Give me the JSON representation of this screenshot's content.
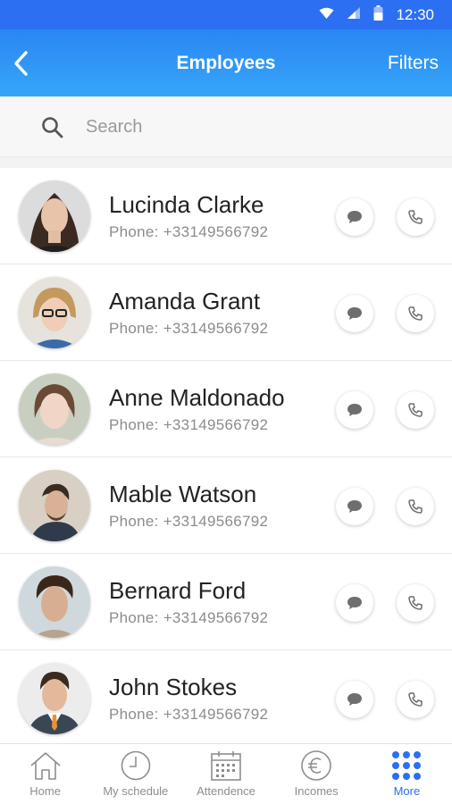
{
  "status_bar": {
    "time": "12:30"
  },
  "app_bar": {
    "title": "Employees",
    "filters_label": "Filters"
  },
  "search": {
    "placeholder": "Search",
    "value": ""
  },
  "employees": [
    {
      "name": "Lucinda Clarke",
      "phone": "Phone: +33149566792"
    },
    {
      "name": "Amanda Grant",
      "phone": "Phone: +33149566792"
    },
    {
      "name": "Anne Maldonado",
      "phone": "Phone: +33149566792"
    },
    {
      "name": "Mable Watson",
      "phone": "Phone: +33149566792"
    },
    {
      "name": "Bernard Ford",
      "phone": "Phone: +33149566792"
    },
    {
      "name": "John Stokes",
      "phone": "Phone: +33149566792"
    }
  ],
  "bottom_nav": [
    {
      "label": "Home",
      "icon": "home-icon",
      "active": false
    },
    {
      "label": "My schedule",
      "icon": "clock-icon",
      "active": false
    },
    {
      "label": "Attendence",
      "icon": "calendar-icon",
      "active": false
    },
    {
      "label": "Incomes",
      "icon": "euro-icon",
      "active": false
    },
    {
      "label": "More",
      "icon": "grid-icon",
      "active": true
    }
  ],
  "colors": {
    "primary": "#2d6ff3",
    "app_bar_light": "#36a6f8",
    "inactive": "#8d8d8d"
  }
}
